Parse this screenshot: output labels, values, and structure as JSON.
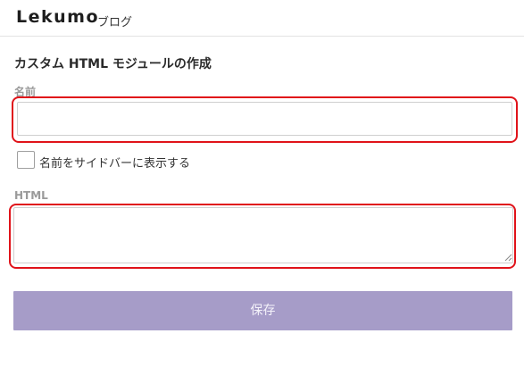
{
  "header": {
    "brand": "Lekumo",
    "brand_sub": "ブログ"
  },
  "page": {
    "title": "カスタム HTML モジュールの作成"
  },
  "form": {
    "name_label": "名前",
    "name_value": "",
    "show_name_checkbox_label": "名前をサイドバーに表示する",
    "show_name_checked": false,
    "html_label": "HTML",
    "html_value": "",
    "save_label": "保存"
  },
  "colors": {
    "accent_button": "#a69cc8",
    "highlight_border": "#e0131a"
  }
}
